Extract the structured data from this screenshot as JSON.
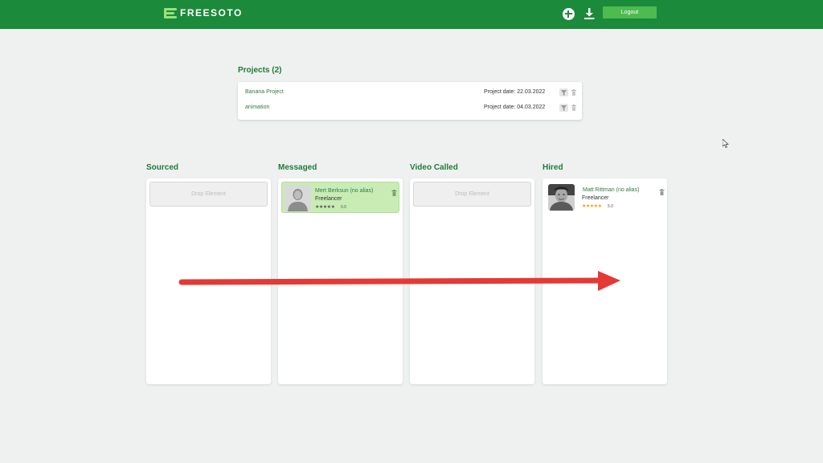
{
  "app": {
    "logo_text": "FREESOTO",
    "logout_label": "Logout",
    "add_icon": "plus-circle-icon",
    "download_icon": "download-icon"
  },
  "projects": {
    "title": "Projects (2)",
    "rows": [
      {
        "name": "Banana Project",
        "date": "Project date: 22.03.2022"
      },
      {
        "name": "animation",
        "date": "Project date: 04.03.2022"
      }
    ]
  },
  "board": {
    "columns": [
      {
        "title": "Sourced",
        "drop_label": "Drop Element"
      },
      {
        "title": "Messaged"
      },
      {
        "title": "Video Called",
        "drop_label": "Drop Element"
      },
      {
        "title": "Hired"
      }
    ],
    "messaged_card": {
      "name": "Mert Berksun (no alias)",
      "role": "Freelancer",
      "rating": "0.0",
      "stars_filled": 0
    },
    "hired_card": {
      "name": "Matt Rittman (no alias)",
      "role": "Freelancer",
      "rating": "5.0",
      "stars_filled": 5
    }
  },
  "colors": {
    "brand": "#1b8a3a",
    "accent": "#4dbb4f",
    "card_highlight": "#c9ecb5",
    "arrow": "#e53935",
    "star_filled": "#f39c12",
    "star_empty": "#555555"
  }
}
